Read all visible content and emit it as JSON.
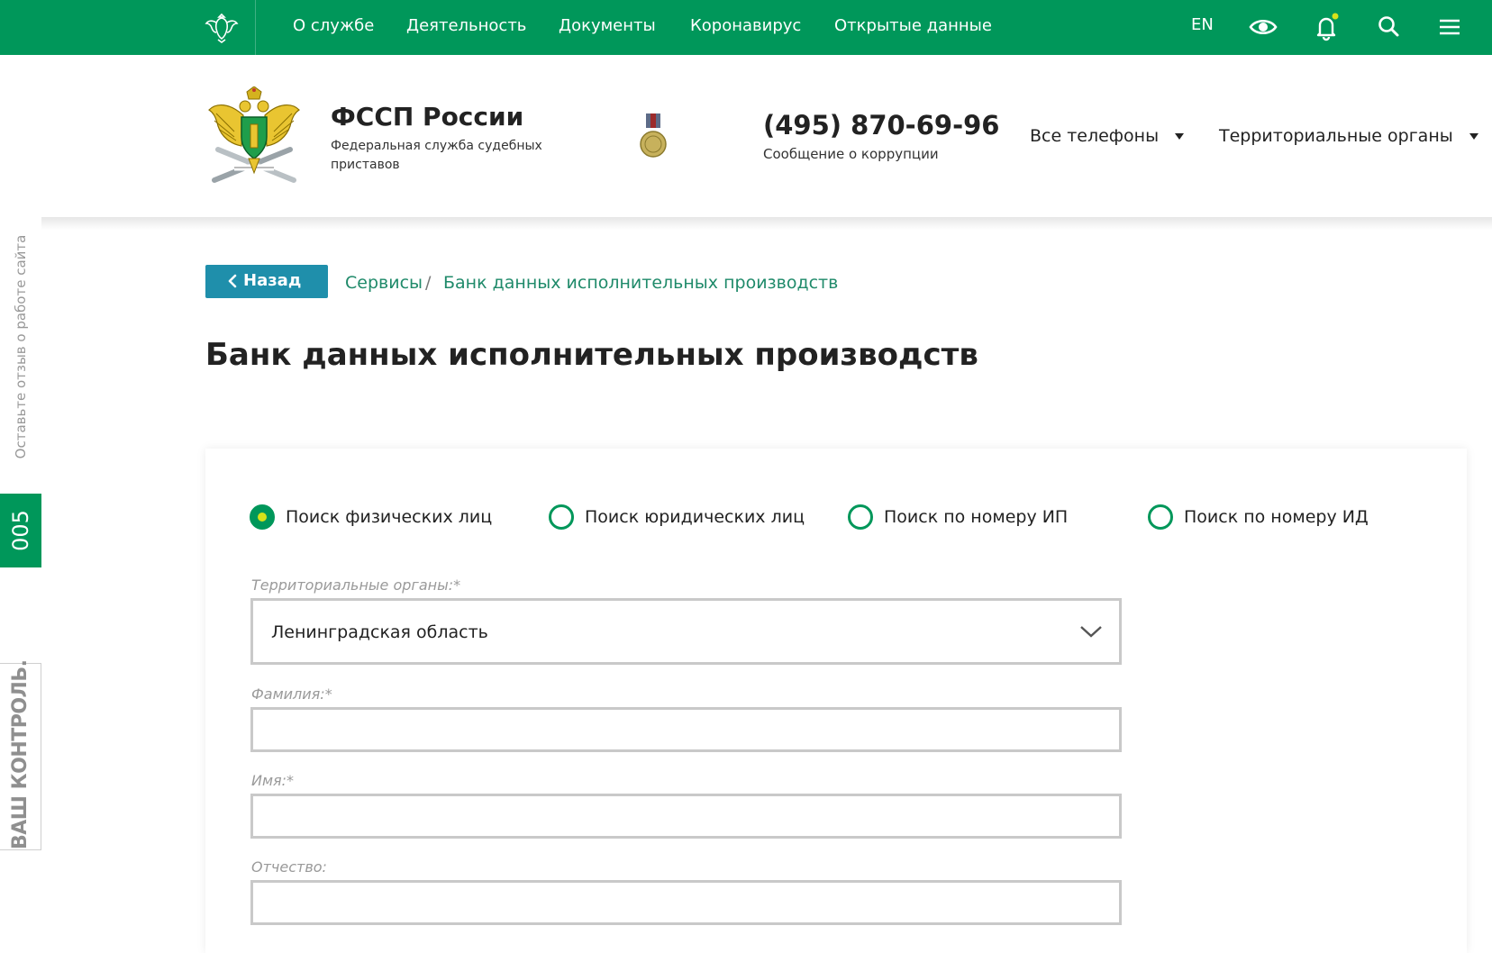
{
  "topnav": {
    "items": [
      "О службе",
      "Деятельность",
      "Документы",
      "Коронавирус",
      "Открытые данные"
    ],
    "lang": "EN",
    "icons": [
      "eye-icon",
      "bell-icon",
      "search-icon",
      "menu-icon"
    ],
    "accent": "#00975a"
  },
  "header": {
    "org_name": "ФССП России",
    "org_sub": "Федеральная служба судебных приставов",
    "phone": "(495) 870-69-96",
    "phone_sub": "Сообщение о коррупции",
    "dropdowns": [
      "Все телефоны",
      "Территориальные органы"
    ]
  },
  "side": {
    "feedback": "Оставьте отзыв о работе сайта",
    "badge": "005",
    "control": "ВАШ КОНТРОЛЬ."
  },
  "breadcrumb": {
    "back": "Назад",
    "items": [
      "Сервисы",
      "Банк данных исполнительных производств"
    ],
    "separator": "/"
  },
  "page": {
    "title": "Банк данных исполнительных производств"
  },
  "form": {
    "search_types": [
      {
        "label": "Поиск физических лиц",
        "checked": true
      },
      {
        "label": "Поиск юридических лиц",
        "checked": false
      },
      {
        "label": "Поиск по номеру ИП",
        "checked": false
      },
      {
        "label": "Поиск по номеру ИД",
        "checked": false
      }
    ],
    "territory": {
      "label": "Территориальные органы:*",
      "value": "Ленинградская область"
    },
    "lastname": {
      "label": "Фамилия:*",
      "value": ""
    },
    "firstname": {
      "label": "Имя:*",
      "value": ""
    },
    "patronymic": {
      "label": "Отчество:",
      "value": ""
    }
  }
}
